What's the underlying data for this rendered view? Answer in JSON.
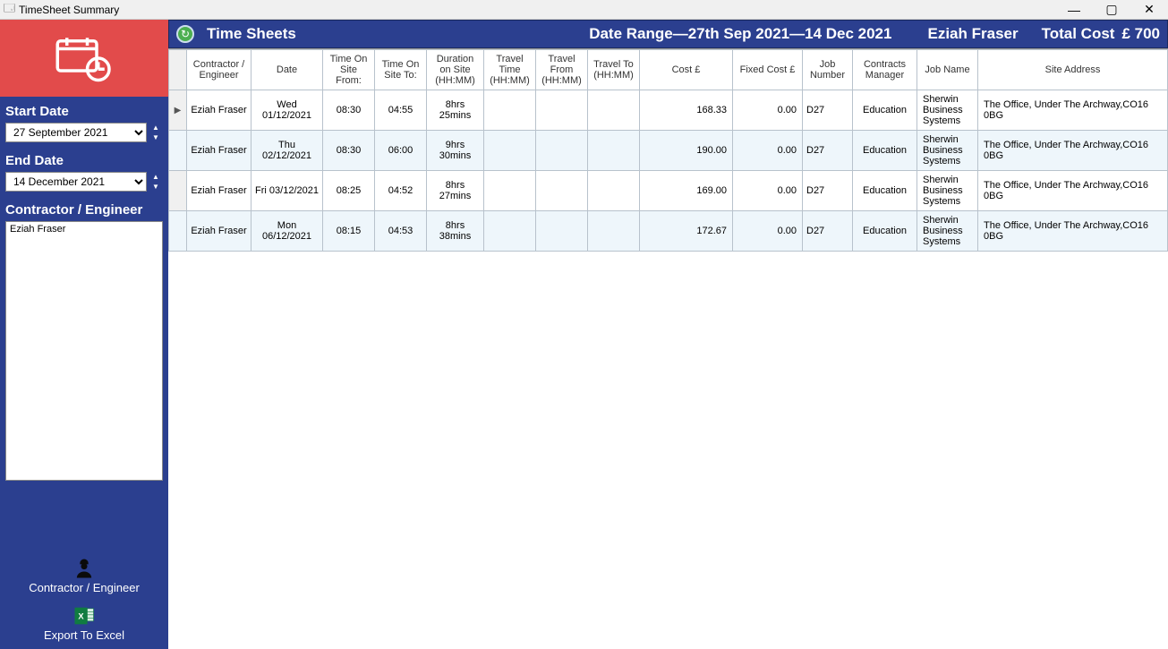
{
  "window": {
    "title": "TimeSheet Summary"
  },
  "sidebar": {
    "start_label": "Start Date",
    "start_value": "27 September 2021",
    "end_label": "End Date",
    "end_value": "14 December 2021",
    "contractor_label": "Contractor / Engineer",
    "contractor_selected": "Eziah Fraser",
    "btn_contractor": "Contractor / Engineer",
    "btn_export": "Export To Excel"
  },
  "header": {
    "title": "Time Sheets",
    "date_range": "Date Range—27th Sep 2021—14 Dec 2021",
    "user": "Eziah Fraser",
    "total_label": "Total Cost",
    "total_value": "£ 700"
  },
  "columns": [
    "Contractor / Engineer",
    "Date",
    "Time On Site From:",
    "Time On Site To:",
    "Duration on Site (HH:MM)",
    "Travel Time (HH:MM)",
    "Travel From (HH:MM)",
    "Travel To (HH:MM)",
    "Cost £",
    "Fixed Cost £",
    "Job Number",
    "Contracts Manager",
    "Job Name",
    "Site Address"
  ],
  "rows": [
    {
      "contractor": "Eziah Fraser",
      "date": "Wed 01/12/2021",
      "from": "08:30",
      "to": "04:55",
      "duration": "8hrs 25mins",
      "travel_time": "",
      "travel_from": "",
      "travel_to": "",
      "cost": "168.33",
      "fixed": "0.00",
      "jobnum": "D27",
      "manager": "Education",
      "jobname": "Sherwin Business Systems",
      "address": "The Office, Under The Archway,CO16 0BG"
    },
    {
      "contractor": "Eziah Fraser",
      "date": "Thu 02/12/2021",
      "from": "08:30",
      "to": "06:00",
      "duration": "9hrs 30mins",
      "travel_time": "",
      "travel_from": "",
      "travel_to": "",
      "cost": "190.00",
      "fixed": "0.00",
      "jobnum": "D27",
      "manager": "Education",
      "jobname": "Sherwin Business Systems",
      "address": "The Office, Under The Archway,CO16 0BG"
    },
    {
      "contractor": "Eziah Fraser",
      "date": "Fri 03/12/2021",
      "from": "08:25",
      "to": "04:52",
      "duration": "8hrs 27mins",
      "travel_time": "",
      "travel_from": "",
      "travel_to": "",
      "cost": "169.00",
      "fixed": "0.00",
      "jobnum": "D27",
      "manager": "Education",
      "jobname": "Sherwin Business Systems",
      "address": "The Office, Under The Archway,CO16 0BG"
    },
    {
      "contractor": "Eziah Fraser",
      "date": "Mon 06/12/2021",
      "from": "08:15",
      "to": "04:53",
      "duration": "8hrs 38mins",
      "travel_time": "",
      "travel_from": "",
      "travel_to": "",
      "cost": "172.67",
      "fixed": "0.00",
      "jobnum": "D27",
      "manager": "Education",
      "jobname": "Sherwin Business Systems",
      "address": "The Office, Under The Archway,CO16 0BG"
    }
  ]
}
